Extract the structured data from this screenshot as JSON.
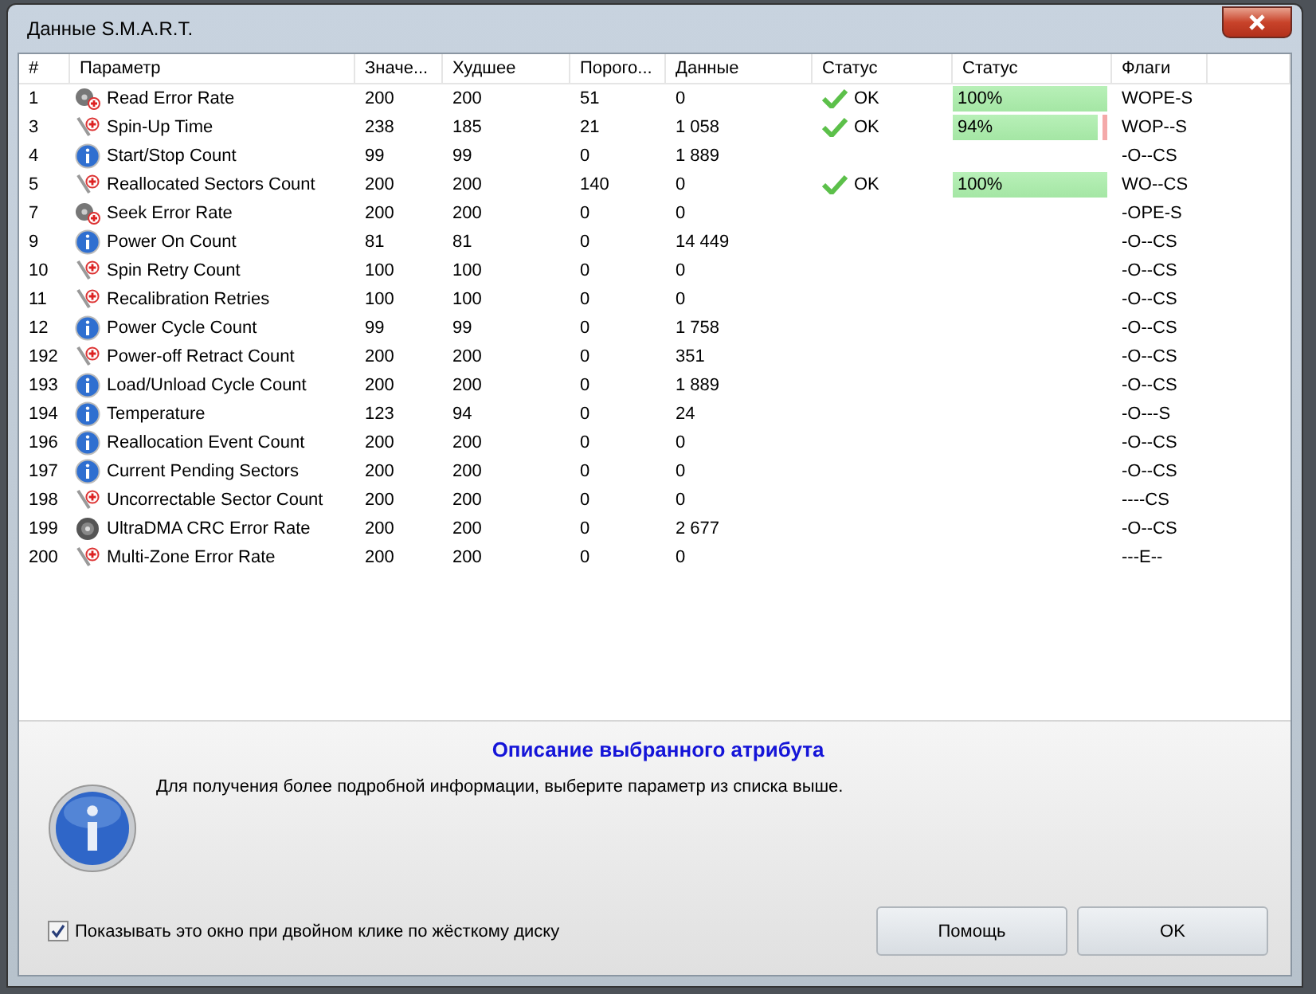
{
  "window": {
    "title": "Данные S.M.A.R.T."
  },
  "table": {
    "columns": [
      "#",
      "Параметр",
      "Значе...",
      "Худшее",
      "Порого...",
      "Данные",
      "Статус",
      "Статус",
      "Флаги"
    ],
    "rows": [
      {
        "id": "1",
        "kind": "disk",
        "name": "Read Error Rate",
        "value": "200",
        "worst": "200",
        "threshold": "51",
        "data": "0",
        "status": "OK",
        "health": {
          "label": "100%",
          "level": 1
        },
        "flags": "WOPE-S"
      },
      {
        "id": "3",
        "kind": "tool",
        "name": "Spin-Up Time",
        "value": "238",
        "worst": "185",
        "threshold": "21",
        "data": "1 058",
        "status": "OK",
        "health": {
          "label": "94%",
          "level": 0.94
        },
        "flags": "WOP--S"
      },
      {
        "id": "4",
        "kind": "info",
        "name": "Start/Stop Count",
        "value": "99",
        "worst": "99",
        "threshold": "0",
        "data": "1 889",
        "flags": "-O--CS"
      },
      {
        "id": "5",
        "kind": "tool",
        "name": "Reallocated Sectors Count",
        "value": "200",
        "worst": "200",
        "threshold": "140",
        "data": "0",
        "status": "OK",
        "health": {
          "label": "100%",
          "level": 1
        },
        "flags": "WO--CS"
      },
      {
        "id": "7",
        "kind": "disk",
        "name": "Seek Error Rate",
        "value": "200",
        "worst": "200",
        "threshold": "0",
        "data": "0",
        "flags": "-OPE-S"
      },
      {
        "id": "9",
        "kind": "info",
        "name": "Power On Count",
        "value": "81",
        "worst": "81",
        "threshold": "0",
        "data": "14 449",
        "flags": "-O--CS"
      },
      {
        "id": "10",
        "kind": "tool",
        "name": "Spin Retry Count",
        "value": "100",
        "worst": "100",
        "threshold": "0",
        "data": "0",
        "flags": "-O--CS"
      },
      {
        "id": "11",
        "kind": "tool",
        "name": "Recalibration Retries",
        "value": "100",
        "worst": "100",
        "threshold": "0",
        "data": "0",
        "flags": "-O--CS"
      },
      {
        "id": "12",
        "kind": "info",
        "name": "Power Cycle Count",
        "value": "99",
        "worst": "99",
        "threshold": "0",
        "data": "1 758",
        "flags": "-O--CS"
      },
      {
        "id": "192",
        "kind": "tool",
        "name": "Power-off Retract Count",
        "value": "200",
        "worst": "200",
        "threshold": "0",
        "data": "351",
        "flags": "-O--CS"
      },
      {
        "id": "193",
        "kind": "info",
        "name": "Load/Unload Cycle Count",
        "value": "200",
        "worst": "200",
        "threshold": "0",
        "data": "1 889",
        "flags": "-O--CS"
      },
      {
        "id": "194",
        "kind": "info",
        "name": "Temperature",
        "value": "123",
        "worst": "94",
        "threshold": "0",
        "data": "24",
        "flags": "-O---S"
      },
      {
        "id": "196",
        "kind": "info",
        "name": "Reallocation Event Count",
        "value": "200",
        "worst": "200",
        "threshold": "0",
        "data": "0",
        "flags": "-O--CS"
      },
      {
        "id": "197",
        "kind": "info",
        "name": "Current Pending Sectors",
        "value": "200",
        "worst": "200",
        "threshold": "0",
        "data": "0",
        "flags": "-O--CS"
      },
      {
        "id": "198",
        "kind": "tool",
        "name": "Uncorrectable Sector Count",
        "value": "200",
        "worst": "200",
        "threshold": "0",
        "data": "0",
        "flags": "----CS"
      },
      {
        "id": "199",
        "kind": "disc",
        "name": "UltraDMA CRC Error Rate",
        "value": "200",
        "worst": "200",
        "threshold": "0",
        "data": "2 677",
        "flags": "-O--CS"
      },
      {
        "id": "200",
        "kind": "tool",
        "name": "Multi-Zone Error Rate",
        "value": "200",
        "worst": "200",
        "threshold": "0",
        "data": "0",
        "flags": "---E--"
      }
    ]
  },
  "description": {
    "title": "Описание выбранного атрибута",
    "text": "Для получения более подробной информации, выберите параметр из списка выше."
  },
  "show_on_double_click": {
    "label": "Показывать это окно при двойном клике по жёсткому диску",
    "checked": true
  },
  "buttons": [
    "Помощь",
    "OK"
  ]
}
